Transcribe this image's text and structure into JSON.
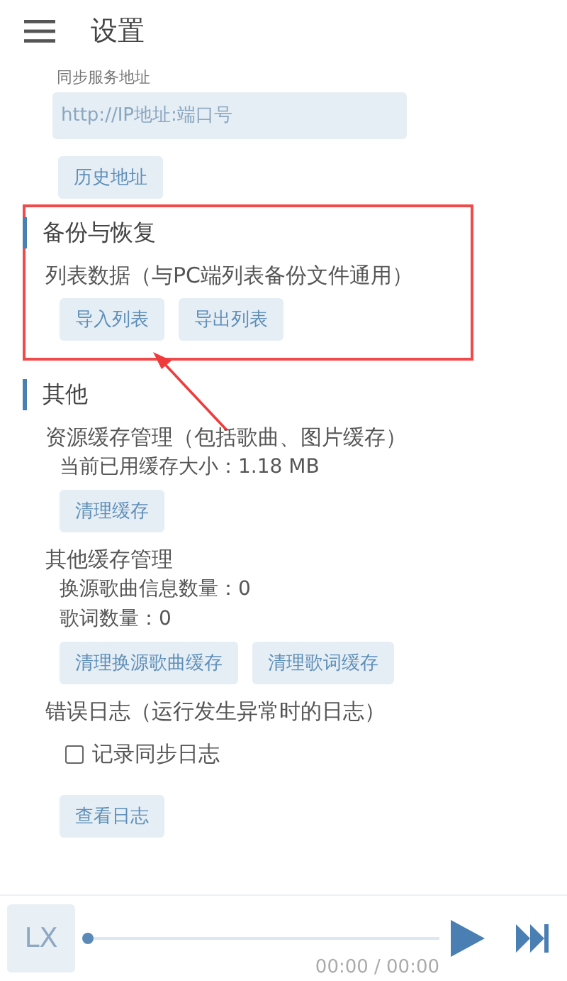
{
  "header": {
    "title": "设置"
  },
  "sync": {
    "label": "同步服务地址",
    "placeholder": "http://IP地址:端口号",
    "buttons": [
      "历史地址"
    ]
  },
  "sections": [
    {
      "title": "备份与恢复",
      "highlighted": true,
      "groups": [
        {
          "title": "列表数据（与PC端列表备份文件通用）",
          "items": [
            {
              "kind": "buttons",
              "buttons": [
                "导入列表",
                "导出列表"
              ]
            }
          ]
        }
      ]
    },
    {
      "title": "其他",
      "highlighted": false,
      "groups": [
        {
          "title": "资源缓存管理（包括歌曲、图片缓存）",
          "items": [
            {
              "kind": "info",
              "text": "当前已用缓存大小：1.18 MB"
            },
            {
              "kind": "buttons",
              "buttons": [
                "清理缓存"
              ]
            }
          ]
        },
        {
          "title": "其他缓存管理",
          "items": [
            {
              "kind": "info",
              "text": "换源歌曲信息数量：0"
            },
            {
              "kind": "info",
              "text": "歌词数量：0"
            },
            {
              "kind": "buttons",
              "buttons": [
                "清理换源歌曲缓存",
                "清理歌词缓存"
              ]
            }
          ]
        },
        {
          "title": "错误日志（运行发生异常时的日志）",
          "items": [
            {
              "kind": "checkbox",
              "label": "记录同步日志",
              "checked": false
            },
            {
              "kind": "buttons",
              "buttons": [
                "查看日志"
              ]
            }
          ]
        }
      ]
    }
  ],
  "player": {
    "cover": "LX",
    "level": 0,
    "time": "00:00 / 00:00"
  }
}
